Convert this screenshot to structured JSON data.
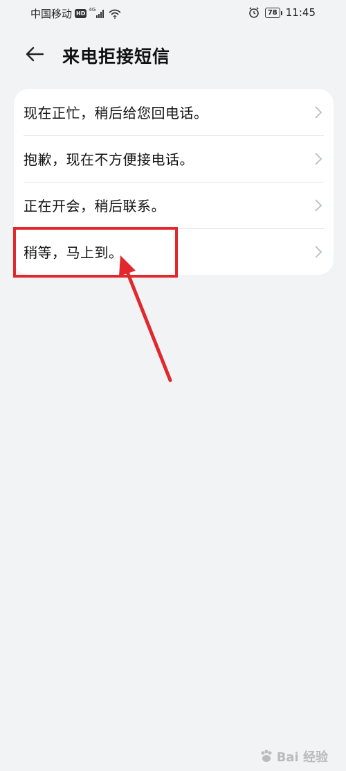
{
  "status_bar": {
    "carrier": "中国移动",
    "hd": "HD",
    "network": "4G",
    "battery": "78",
    "time": "11:45"
  },
  "header": {
    "title": "来电拒接短信"
  },
  "messages": [
    "现在正忙，稍后给您回电话。",
    "抱歉，现在不方便接电话。",
    "正在开会，稍后联系。",
    "稍等，马上到。"
  ],
  "annotation": {
    "color": "#e0282d"
  },
  "watermark": {
    "text": "Bai 经验"
  }
}
